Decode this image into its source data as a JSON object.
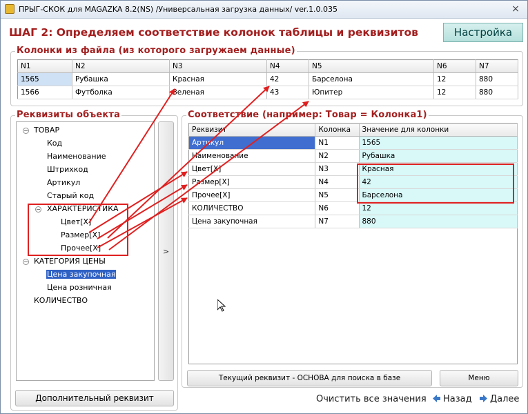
{
  "window": {
    "title": "ПРЫГ-СКОК для MAGAZKA 8.2(NS)  /Универсальная загрузка данных/ ver.1.0.035",
    "close_glyph": "×"
  },
  "header": {
    "step_title": "ШАГ 2: Определяем соответствие колонок таблицы и реквизитов",
    "settings_label": "Настройка"
  },
  "file_columns": {
    "legend": "Колонки из файла (из которого загружаем данные)",
    "headers": [
      "N1",
      "N2",
      "N3",
      "N4",
      "N5",
      "N6",
      "N7"
    ],
    "rows": [
      [
        "1565",
        "Рубашка",
        "Красная",
        "42",
        "Барселона",
        "12",
        "880"
      ],
      [
        "1566",
        "Футболка",
        "Зеленая",
        "43",
        "Юпитер",
        "12",
        "880"
      ]
    ]
  },
  "object_props": {
    "legend": "Реквизиты объекта",
    "tree": {
      "goods": "ТОВАР",
      "code": "Код",
      "name": "Наименование",
      "barcode": "Штрихкод",
      "article": "Артикул",
      "old_code": "Старый код",
      "characteristic": "ХАРАКТЕРИСТИКА",
      "color": "Цвет[X]",
      "size": "Размер[X]",
      "other": "Прочее[X]",
      "price_category": "КАТЕГОРИЯ ЦЕНЫ",
      "purchase_price": "Цена закупочная",
      "retail_price": "Цена розничная",
      "quantity": "КОЛИЧЕСТВО"
    },
    "move_arrow": ">"
  },
  "mapping": {
    "legend": "Соответствие (например: Товар = Колонка1)",
    "headers": [
      "Реквизит",
      "Колонка",
      "Значение для колонки"
    ],
    "rows": [
      [
        "Артикул",
        "N1",
        "1565"
      ],
      [
        "Наименование",
        "N2",
        "Рубашка"
      ],
      [
        "Цвет[X]",
        "N3",
        "Красная"
      ],
      [
        "Размер[X]",
        "N4",
        "42"
      ],
      [
        "Прочее[X]",
        "N5",
        "Барселона"
      ],
      [
        "КОЛИЧЕСТВО",
        "N6",
        "12"
      ],
      [
        "Цена закупочная",
        "N7",
        "880"
      ]
    ]
  },
  "buttons": {
    "current_prop": "Текущий реквизит - ОСНОВА для поиска в базе",
    "menu": "Меню",
    "additional_prop": "Дополнительный реквизит",
    "clear_all": "Очистить все значения",
    "back": "Назад",
    "next": "Далее"
  },
  "colors": {
    "accent_red": "#a31e1e",
    "annotation_red": "#e02020",
    "value_cell": "#d9f8f8",
    "selection_blue": "#3f6ed0"
  }
}
